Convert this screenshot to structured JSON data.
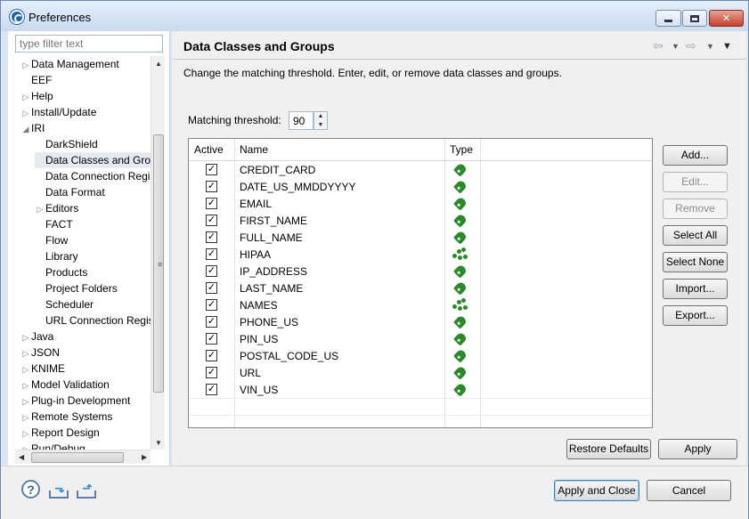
{
  "window": {
    "title": "Preferences"
  },
  "sidebar": {
    "filter_placeholder": "type filter text",
    "items": [
      {
        "label": "Data Management",
        "twisty": "▷",
        "indent": 0
      },
      {
        "label": "EEF",
        "twisty": "",
        "indent": 0
      },
      {
        "label": "Help",
        "twisty": "▷",
        "indent": 0
      },
      {
        "label": "Install/Update",
        "twisty": "▷",
        "indent": 0
      },
      {
        "label": "IRI",
        "twisty": "◢",
        "indent": 0
      },
      {
        "label": "DarkShield",
        "twisty": "",
        "indent": 1
      },
      {
        "label": "Data Classes and Groups",
        "twisty": "",
        "indent": 1,
        "selected": true
      },
      {
        "label": "Data Connection Registry",
        "twisty": "",
        "indent": 1
      },
      {
        "label": "Data Format",
        "twisty": "",
        "indent": 1
      },
      {
        "label": "Editors",
        "twisty": "▷",
        "indent": 1
      },
      {
        "label": "FACT",
        "twisty": "",
        "indent": 1
      },
      {
        "label": "Flow",
        "twisty": "",
        "indent": 1
      },
      {
        "label": "Library",
        "twisty": "",
        "indent": 1
      },
      {
        "label": "Products",
        "twisty": "",
        "indent": 1
      },
      {
        "label": "Project Folders",
        "twisty": "",
        "indent": 1
      },
      {
        "label": "Scheduler",
        "twisty": "",
        "indent": 1
      },
      {
        "label": "URL Connection Registry",
        "twisty": "",
        "indent": 1
      },
      {
        "label": "Java",
        "twisty": "▷",
        "indent": 0
      },
      {
        "label": "JSON",
        "twisty": "▷",
        "indent": 0
      },
      {
        "label": "KNIME",
        "twisty": "▷",
        "indent": 0
      },
      {
        "label": "Model Validation",
        "twisty": "▷",
        "indent": 0
      },
      {
        "label": "Plug-in Development",
        "twisty": "▷",
        "indent": 0
      },
      {
        "label": "Remote Systems",
        "twisty": "▷",
        "indent": 0
      },
      {
        "label": "Report Design",
        "twisty": "▷",
        "indent": 0
      },
      {
        "label": "Run/Debug",
        "twisty": "▷",
        "indent": 0
      }
    ]
  },
  "page": {
    "title": "Data Classes and Groups",
    "description": "Change the matching threshold. Enter, edit, or remove data classes and groups.",
    "threshold_label": "Matching threshold:",
    "threshold_value": "90"
  },
  "table": {
    "columns": [
      "Active",
      "Name",
      "Type"
    ],
    "rows": [
      {
        "name": "CREDIT_CARD",
        "active": true,
        "type": "class"
      },
      {
        "name": "DATE_US_MMDDYYYY",
        "active": true,
        "type": "class"
      },
      {
        "name": "EMAIL",
        "active": true,
        "type": "class"
      },
      {
        "name": "FIRST_NAME",
        "active": true,
        "type": "class"
      },
      {
        "name": "FULL_NAME",
        "active": true,
        "type": "class"
      },
      {
        "name": "HIPAA",
        "active": true,
        "type": "group"
      },
      {
        "name": "IP_ADDRESS",
        "active": true,
        "type": "class"
      },
      {
        "name": "LAST_NAME",
        "active": true,
        "type": "class"
      },
      {
        "name": "NAMES",
        "active": true,
        "type": "group"
      },
      {
        "name": "PHONE_US",
        "active": true,
        "type": "class"
      },
      {
        "name": "PIN_US",
        "active": true,
        "type": "class"
      },
      {
        "name": "POSTAL_CODE_US",
        "active": true,
        "type": "class"
      },
      {
        "name": "URL",
        "active": true,
        "type": "class"
      },
      {
        "name": "VIN_US",
        "active": true,
        "type": "class"
      }
    ]
  },
  "buttons": {
    "add": "Add...",
    "edit": "Edit...",
    "remove": "Remove",
    "select_all": "Select All",
    "select_none": "Select None",
    "import": "Import...",
    "export": "Export...",
    "restore_defaults": "Restore Defaults",
    "apply": "Apply",
    "apply_close": "Apply and Close",
    "cancel": "Cancel"
  },
  "icons": {
    "nav_back": "back-arrow-icon",
    "nav_forward": "forward-arrow-icon",
    "view_menu": "view-menu-icon",
    "help": "help-icon",
    "import_prefs": "import-icon",
    "export_prefs": "export-icon"
  },
  "colors": {
    "tag_green": "#2a8a2a",
    "window_frame": "#d8e6f5",
    "selection": "#e4eaf2"
  }
}
